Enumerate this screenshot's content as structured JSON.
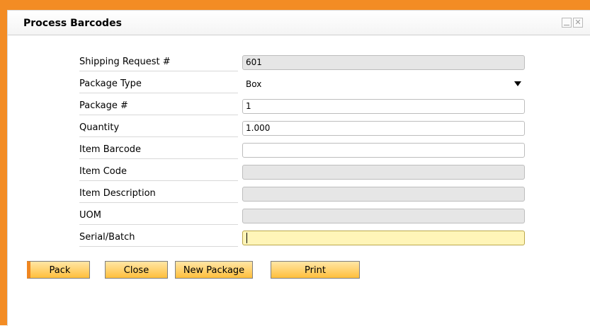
{
  "window": {
    "title": "Process Barcodes",
    "minimize_icon": "minimize-icon",
    "close_icon": "close-icon",
    "close_glyph": "✕"
  },
  "form": {
    "rows": [
      {
        "label": "Shipping Request #",
        "value": "601"
      },
      {
        "label": "Package Type",
        "value": "Box"
      },
      {
        "label": "Package #",
        "value": "1"
      },
      {
        "label": "Quantity",
        "value": "1.000"
      },
      {
        "label": "Item Barcode",
        "value": ""
      },
      {
        "label": "Item Code",
        "value": ""
      },
      {
        "label": "Item Description",
        "value": ""
      },
      {
        "label": "UOM",
        "value": ""
      },
      {
        "label": "Serial/Batch",
        "value": ""
      }
    ]
  },
  "buttons": {
    "pack": "Pack",
    "close": "Close",
    "new_package": "New Package",
    "print": "Print"
  },
  "colors": {
    "window_border": "#f38c24",
    "readonly_field": "#e6e6e6",
    "active_field": "#fff5b8",
    "button_gradient_top": "#ffe6a6",
    "button_gradient_bottom": "#ffbf3c"
  }
}
